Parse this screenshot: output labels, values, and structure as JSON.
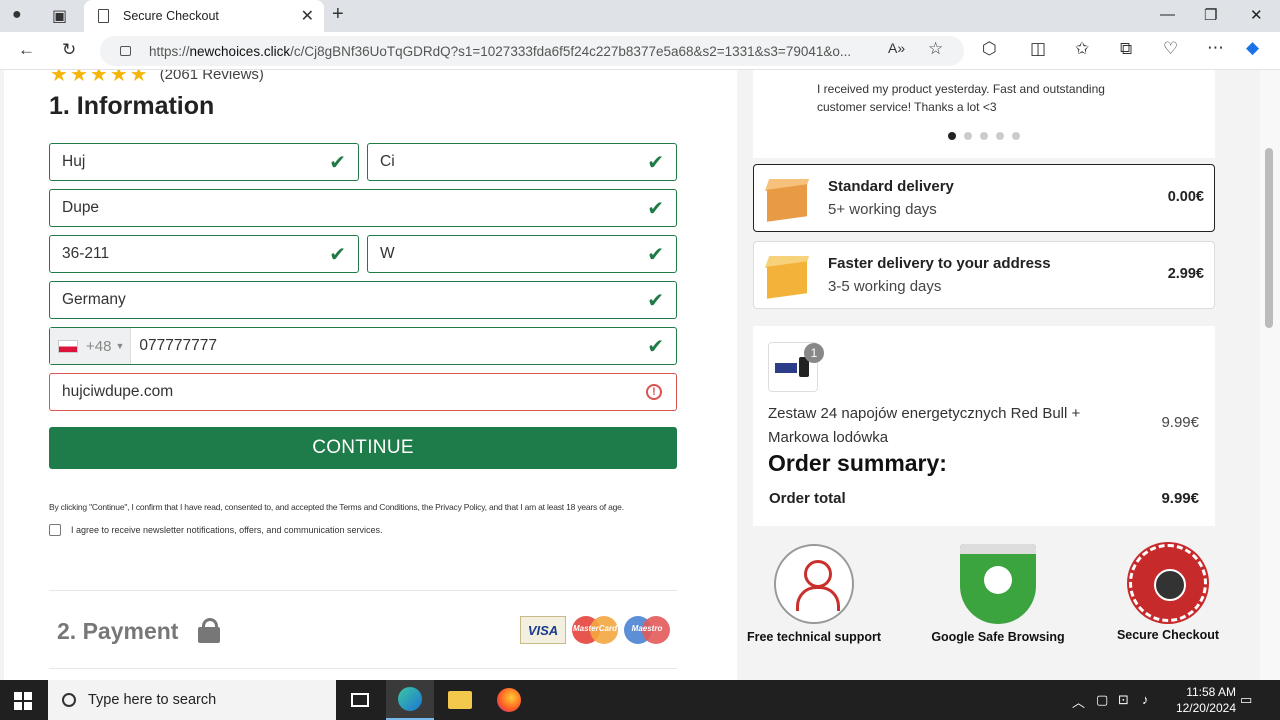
{
  "browser": {
    "tab_title": "Secure Checkout",
    "url_prefix": "https://",
    "url_host": "newchoices.click",
    "url_rest": "/c/Cj8gBNf36UoTqGDRdQ?s1=1027333fda6f5f24c227b8377e5a68&s2=1331&s3=79041&o..."
  },
  "left": {
    "reviews": "(2061 Reviews)",
    "section1_title": "1. Information",
    "fields": {
      "first_name": "Huj",
      "last_name": "Ci",
      "address": "Dupe",
      "zip": "36-211",
      "city": "W",
      "country": "Germany",
      "phone_prefix": "+48",
      "phone": "077777777",
      "email": "hujciwdupe.com"
    },
    "continue_label": "CONTINUE",
    "legal_text": "By clicking \"Continue\", I confirm that I have read, consented to, and accepted the Terms and Conditions, the Privacy Policy, and that I am at least 18 years of age.",
    "newsletter_text": "I agree to receive newsletter notifications, offers, and communication services.",
    "section2_title": "2. Payment",
    "cards": [
      "VISA",
      "MasterCard",
      "Maestro"
    ]
  },
  "right": {
    "review_text": "I received my product yesterday. Fast and outstanding customer service! Thanks a lot <3",
    "delivery_options": [
      {
        "name": "Standard delivery",
        "sub": "5+ working days",
        "price": "0.00€",
        "selected": true
      },
      {
        "name": "Faster delivery to your address",
        "sub": "3-5 working days",
        "price": "2.99€",
        "selected": false
      }
    ],
    "product": {
      "qty": "1",
      "name": "Zestaw 24 napojów energetycznych Red Bull + Markowa lodówka",
      "price": "9.99€"
    },
    "summary_title": "Order summary:",
    "total_label": "Order total",
    "total_value": "9.99€",
    "trust": [
      "Free technical support",
      "Google Safe Browsing",
      "Secure Checkout"
    ]
  },
  "taskbar": {
    "search_placeholder": "Type here to search",
    "time": "11:58 AM",
    "date": "12/20/2024"
  },
  "colors": {
    "accent_green": "#1e7b4a",
    "error_red": "#d9534f"
  }
}
